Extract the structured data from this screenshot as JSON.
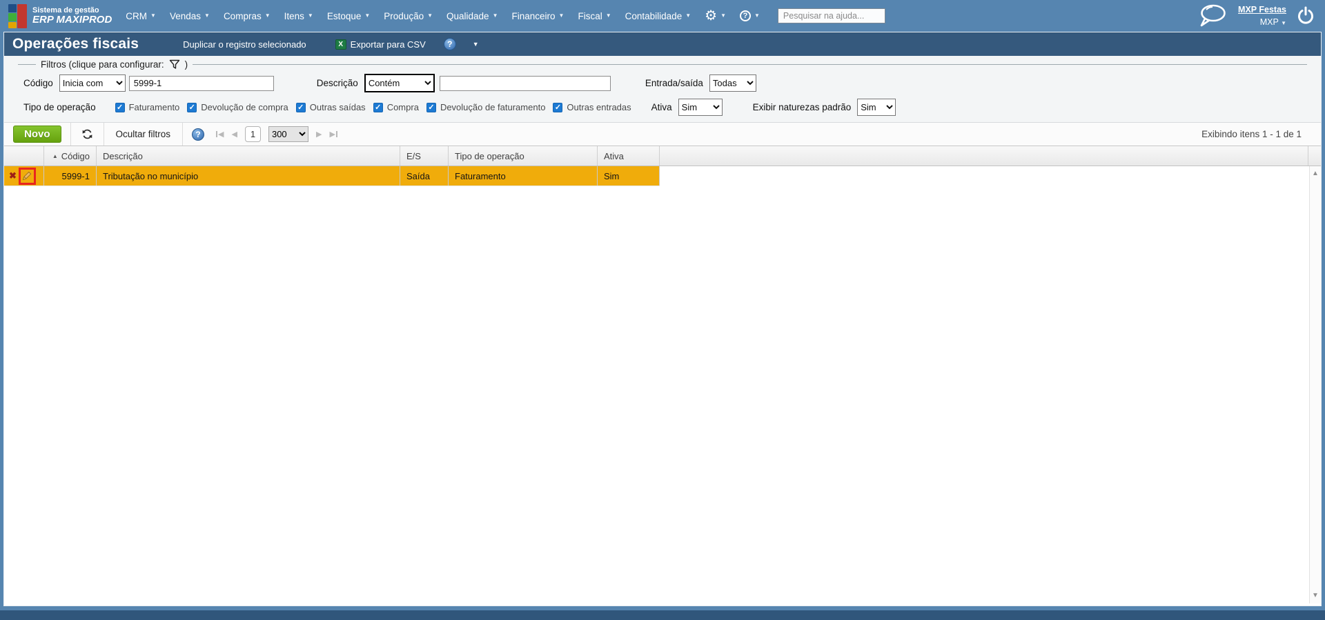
{
  "topbar": {
    "logo": {
      "tagline": "Sistema de gestão",
      "brand": "ERP MAXIPROD"
    },
    "menus": [
      "CRM",
      "Vendas",
      "Compras",
      "Itens",
      "Estoque",
      "Produção",
      "Qualidade",
      "Financeiro",
      "Fiscal",
      "Contabilidade"
    ],
    "search_placeholder": "Pesquisar na ajuda...",
    "account_link": "MXP Festas",
    "account_short": "MXP"
  },
  "titlebar": {
    "title": "Operações fiscais",
    "duplicate_label": "Duplicar o registro selecionado",
    "export_label": "Exportar para CSV"
  },
  "filters": {
    "legend_prefix": "Filtros (clique para configurar:",
    "legend_suffix": ")",
    "codigo_label": "Código",
    "codigo_operator": "Inicia com",
    "codigo_value": "5999-1",
    "descricao_label": "Descrição",
    "descricao_operator": "Contém",
    "descricao_value": "",
    "entrada_saida_label": "Entrada/saída",
    "entrada_saida_value": "Todas",
    "tipo_operacao_label": "Tipo de operação",
    "tipo_options": [
      "Faturamento",
      "Devolução de compra",
      "Outras saídas",
      "Compra",
      "Devolução de faturamento",
      "Outras entradas"
    ],
    "ativa_label": "Ativa",
    "ativa_value": "Sim",
    "exibir_label": "Exibir naturezas padrão",
    "exibir_value": "Sim"
  },
  "toolbar": {
    "new_label": "Novo",
    "hide_filters_label": "Ocultar filtros",
    "page_current": "1",
    "page_size": "300",
    "items_info": "Exibindo itens 1 - 1 de 1"
  },
  "table": {
    "columns": {
      "codigo": "Código",
      "descricao": "Descrição",
      "es": "E/S",
      "tipo": "Tipo de operação",
      "ativa": "Ativa"
    },
    "rows": [
      {
        "codigo": "5999-1",
        "descricao": "Tributação no município",
        "es": "Saída",
        "tipo": "Faturamento",
        "ativa": "Sim"
      }
    ]
  },
  "colors": {
    "topbar_blue": "#5685b0",
    "titlebar_navy": "#35597d",
    "row_highlight": "#f0ac0b",
    "new_button_green": "#70ad17",
    "annotation_red": "#e8251f",
    "checkbox_blue": "#1d7ad3"
  }
}
